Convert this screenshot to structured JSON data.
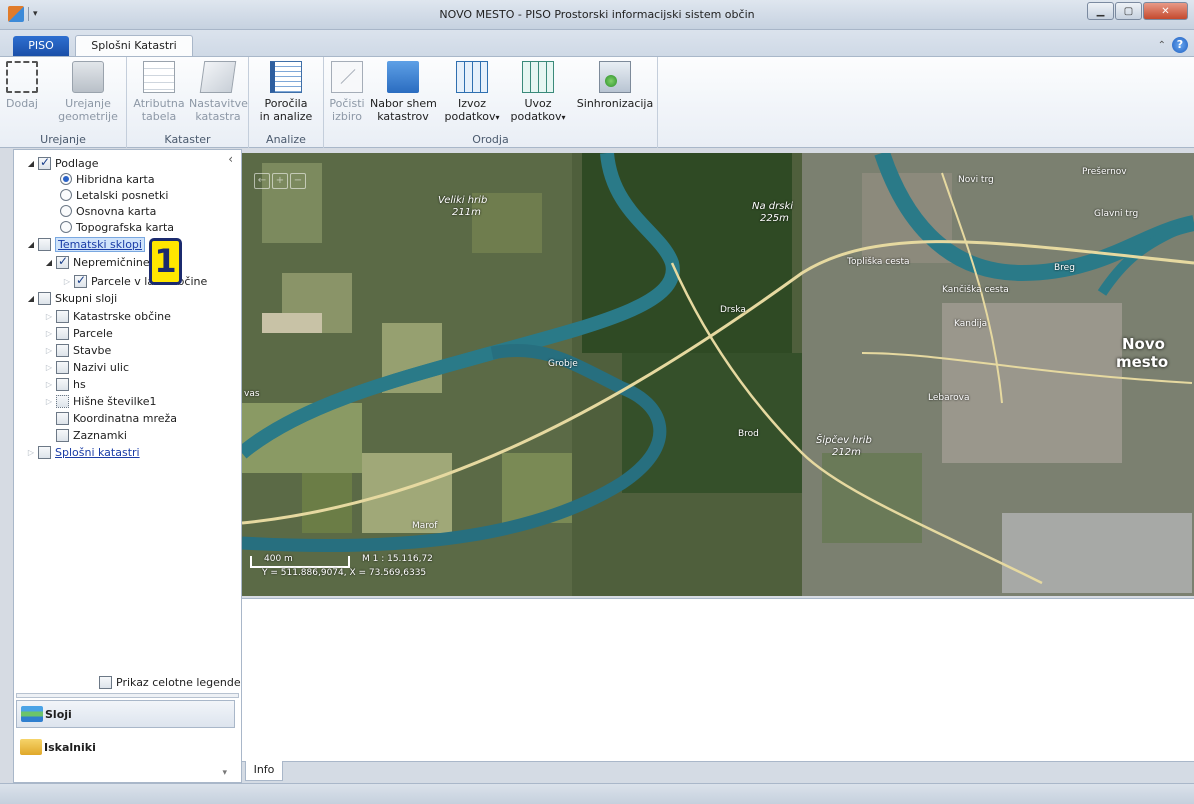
{
  "window": {
    "title": "NOVO MESTO - PISO Prostorski informacijski sistem občin",
    "controls": [
      "minimize",
      "maximize",
      "close"
    ]
  },
  "ribbon": {
    "tabs": [
      {
        "label": "PISO",
        "active": false
      },
      {
        "label": "Splošni Katastri",
        "active": true
      }
    ],
    "groups": [
      {
        "label": "Urejanje",
        "buttons": [
          {
            "line1": "Dodaj",
            "line2": "",
            "enabled": false,
            "icon": "add-polygon-icon"
          },
          {
            "line1": "Urejanje",
            "line2": "geometrije",
            "enabled": false,
            "icon": "lock-icon"
          }
        ]
      },
      {
        "label": "Kataster",
        "buttons": [
          {
            "line1": "Atributna",
            "line2": "tabela",
            "enabled": false,
            "icon": "table-icon"
          },
          {
            "line1": "Nastavitve",
            "line2": "katastra",
            "enabled": false,
            "icon": "settings-icon"
          }
        ]
      },
      {
        "label": "Analize",
        "buttons": [
          {
            "line1": "Poročila",
            "line2": "in analize",
            "enabled": true,
            "icon": "report-icon"
          }
        ]
      },
      {
        "label": "Orodja",
        "buttons": [
          {
            "line1": "Počisti",
            "line2": "izbiro",
            "enabled": false,
            "icon": "clear-selection-icon"
          },
          {
            "line1": "Nabor shem",
            "line2": "katastrov",
            "enabled": true,
            "icon": "schema-icon"
          },
          {
            "line1": "Izvoz",
            "line2": "podatkov",
            "enabled": true,
            "icon": "export-icon",
            "dropdown": true
          },
          {
            "line1": "Uvoz",
            "line2": "podatkov",
            "enabled": true,
            "icon": "import-icon",
            "dropdown": true
          },
          {
            "line1": "Sinhronizacija",
            "line2": "",
            "enabled": true,
            "icon": "sync-icon"
          }
        ]
      }
    ]
  },
  "layers": {
    "podlage": {
      "label": "Podlage",
      "checked": true,
      "options": [
        {
          "label": "Hibridna karta",
          "selected": true
        },
        {
          "label": "Letalski posnetki",
          "selected": false
        },
        {
          "label": "Osnovna karta",
          "selected": false
        },
        {
          "label": "Topografska karta",
          "selected": false
        }
      ]
    },
    "tematski": {
      "label": "Tematski sklopi",
      "checked": false,
      "children": [
        {
          "label": "Nepremičnine",
          "checked": true
        },
        {
          "label": "Parcele v lasti občine",
          "checked": true
        }
      ]
    },
    "skupni": {
      "label": "Skupni sloji",
      "checked": false,
      "children": [
        {
          "label": "Katastrske občine",
          "checked": false
        },
        {
          "label": "Parcele",
          "checked": false
        },
        {
          "label": "Stavbe",
          "checked": false
        },
        {
          "label": "Nazivi ulic",
          "checked": false
        },
        {
          "label": "hs",
          "checked": false
        },
        {
          "label": "Hišne številke1",
          "checked": false
        },
        {
          "label": "Koordinatna mreža",
          "checked": false
        },
        {
          "label": "Zaznamki",
          "checked": false
        }
      ]
    },
    "splosni": {
      "label": "Splošni katastri",
      "checked": false
    }
  },
  "badge": "1",
  "legend_toggle": {
    "label": "Prikaz celotne legende",
    "checked": false
  },
  "nav": {
    "sloji": "Sloji",
    "iskalniki": "Iskalniki"
  },
  "map": {
    "labels": {
      "veliki_hrib": "Veliki hrib",
      "veliki_hrib_h": "211m",
      "na_drski": "Na drski",
      "na_drski_h": "225m",
      "novo_mesto_1": "Novo",
      "novo_mesto_2": "mesto",
      "drska": "Drska",
      "grobje": "Grobje",
      "brod": "Brod",
      "sipcev_hrib": "Šipčev hrib",
      "sipcev_hrib_h": "212m",
      "maroof": "Marof",
      "vas": "vas",
      "kandija": "Kandija",
      "toplicka": "Topliška cesta",
      "novi_trg": "Novi trg",
      "presernov": "Prešernov",
      "glavni_trg": "Glavni trg",
      "kanciska": "Kančiška cesta",
      "breg": "Breg",
      "lebarova": "Lebarova"
    },
    "scale_label": "400 m",
    "scale_ratio": "M 1 : 15.116,72",
    "coordinates": "Y = 511.886,9074, X = 73.569,6335"
  },
  "bottom_tab": "Info",
  "colors": {
    "accent": "#1b4fa8",
    "selection": "#cfe3fb",
    "badge": "#ffe600"
  }
}
